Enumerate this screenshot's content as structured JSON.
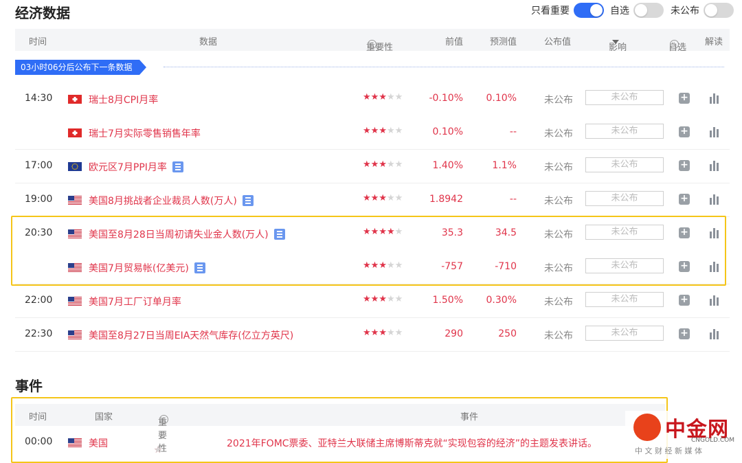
{
  "header": {
    "title": "经济数据",
    "toggles": [
      {
        "label": "只看重要",
        "on": true
      },
      {
        "label": "自选",
        "on": false
      },
      {
        "label": "未公布",
        "on": false
      }
    ]
  },
  "table": {
    "columns": {
      "time": "时间",
      "data": "数据",
      "importance": "重要性",
      "prev": "前值",
      "forecast": "预测值",
      "published": "公布值",
      "impact": "影响",
      "watch": "自选",
      "explain": "解读"
    },
    "countdown": "03小时06分后公布下一条数据",
    "rows": [
      {
        "time": "14:30",
        "flag": "flag-ch",
        "name": "瑞士8月CPI月率",
        "stars": 3,
        "prev": "-0.10%",
        "forecast": "0.10%",
        "published": "未公布",
        "impact": "未公布",
        "doc": false
      },
      {
        "time": "",
        "flag": "flag-ch",
        "name": "瑞士7月实际零售销售年率",
        "stars": 3,
        "prev": "0.10%",
        "forecast": "--",
        "published": "未公布",
        "impact": "未公布",
        "doc": false
      },
      {
        "time": "17:00",
        "flag": "flag-eu",
        "name": "欧元区7月PPI月率",
        "stars": 3,
        "prev": "1.40%",
        "forecast": "1.1%",
        "published": "未公布",
        "impact": "未公布",
        "doc": true
      },
      {
        "time": "19:00",
        "flag": "flag-us",
        "name": "美国8月挑战者企业裁员人数(万人)",
        "stars": 3,
        "prev": "1.8942",
        "forecast": "--",
        "published": "未公布",
        "impact": "未公布",
        "doc": true
      },
      {
        "time": "20:30",
        "flag": "flag-us",
        "name": "美国至8月28日当周初请失业金人数(万人)",
        "stars": 4,
        "prev": "35.3",
        "forecast": "34.5",
        "published": "未公布",
        "impact": "未公布",
        "doc": true
      },
      {
        "time": "",
        "flag": "flag-us",
        "name": "美国7月贸易帐(亿美元)",
        "stars": 3,
        "prev": "-757",
        "forecast": "-710",
        "published": "未公布",
        "impact": "未公布",
        "doc": true
      },
      {
        "time": "22:00",
        "flag": "flag-us",
        "name": "美国7月工厂订单月率",
        "stars": 3,
        "prev": "1.50%",
        "forecast": "0.30%",
        "published": "未公布",
        "impact": "未公布",
        "doc": false
      },
      {
        "time": "22:30",
        "flag": "flag-us",
        "name": "美国至8月27日当周EIA天然气库存(亿立方英尺)",
        "stars": 3,
        "prev": "290",
        "forecast": "250",
        "published": "未公布",
        "impact": "未公布",
        "doc": false
      }
    ]
  },
  "events": {
    "title": "事件",
    "columns": {
      "time": "时间",
      "country": "国家",
      "importance": "重要性",
      "event": "事件"
    },
    "rows": [
      {
        "time": "00:00",
        "flag": "flag-us",
        "country": "美国",
        "stars": 3,
        "event": "2021年FOMC票委、亚特兰大联储主席博斯蒂克就“实现包容的经济”的主题发表讲话。"
      }
    ]
  },
  "watermark": {
    "name": "中金网",
    "domain": "CNGOLD.COM",
    "tagline": "中 文 财 经 新 媒 体"
  },
  "colors": {
    "accent": "#2f6df6",
    "value_red": "#e0344a",
    "highlight": "#f5c518"
  }
}
